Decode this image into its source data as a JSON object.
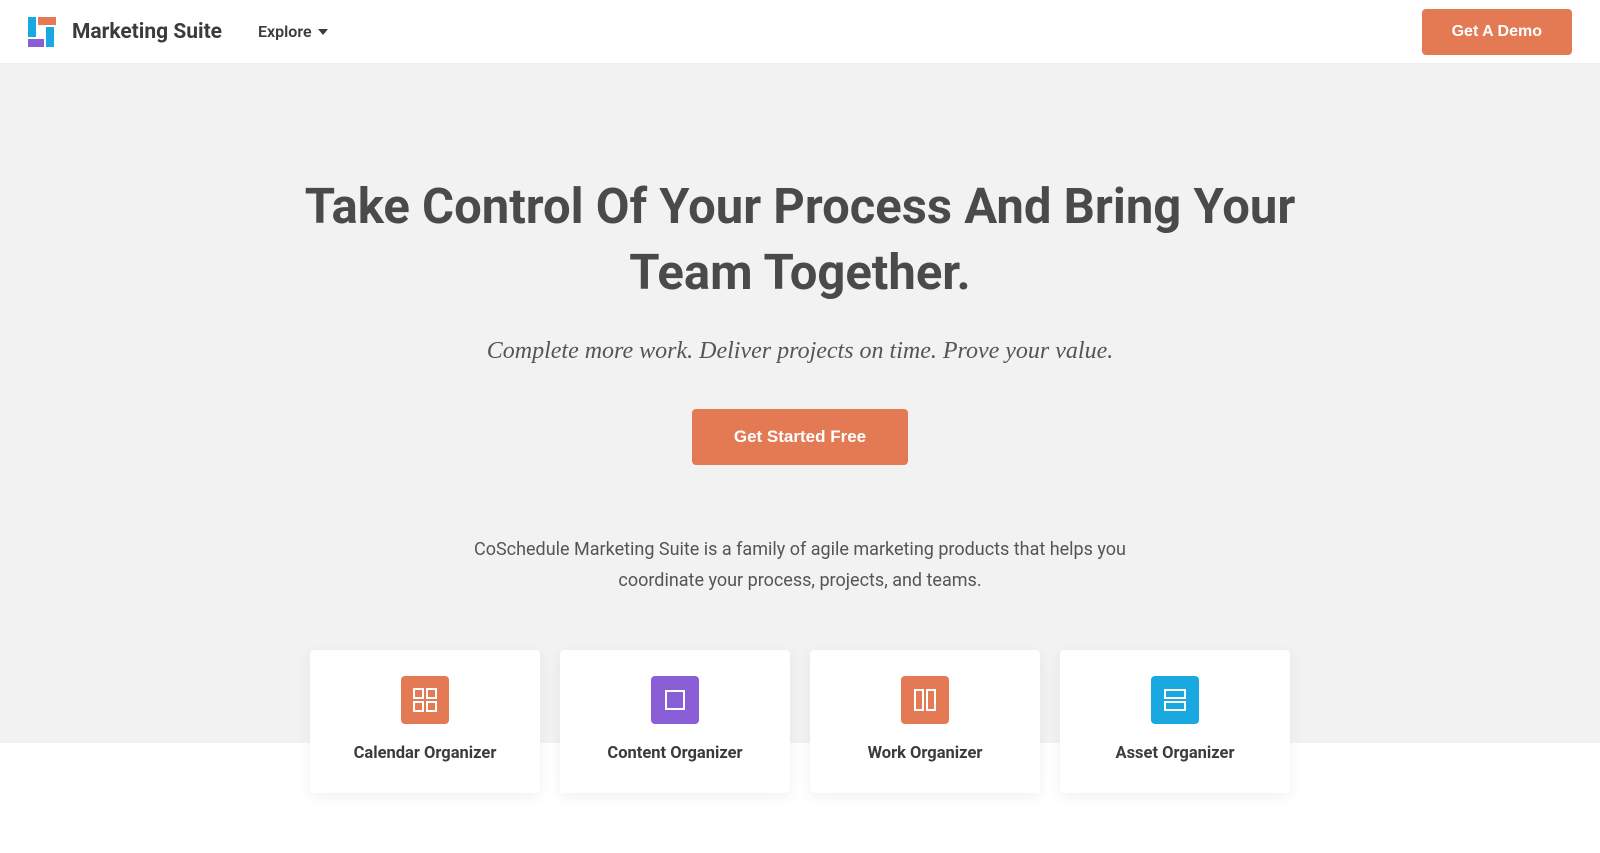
{
  "header": {
    "brand_name": "Marketing Suite",
    "explore_label": "Explore",
    "demo_label": "Get A Demo"
  },
  "hero": {
    "title": "Take Control Of Your Process And Bring Your Team Together.",
    "subtitle": "Complete more work. Deliver projects on time. Prove your value.",
    "cta_label": "Get Started Free",
    "description": "CoSchedule Marketing Suite is a family of agile marketing products that helps you coordinate your process, projects, and teams."
  },
  "cards": [
    {
      "title": "Calendar Organizer",
      "color": "#e37a54",
      "icon": "grid"
    },
    {
      "title": "Content Organizer",
      "color": "#8a5ed6",
      "icon": "square"
    },
    {
      "title": "Work Organizer",
      "color": "#e37a54",
      "icon": "columns"
    },
    {
      "title": "Asset Organizer",
      "color": "#1aa8e0",
      "icon": "rows"
    }
  ]
}
